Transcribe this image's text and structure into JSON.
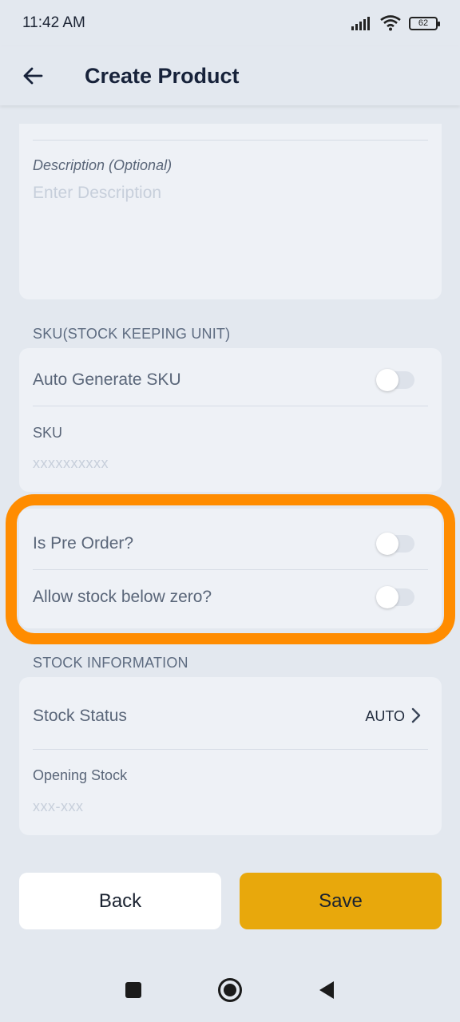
{
  "status_bar": {
    "time": "11:42 AM",
    "battery": "62"
  },
  "app_bar": {
    "title": "Create Product"
  },
  "description": {
    "label": "Description (Optional)",
    "placeholder": "Enter Description"
  },
  "sku_section": {
    "heading": "SKU(STOCK KEEPING UNIT)",
    "auto_generate_label": "Auto Generate SKU",
    "auto_generate_on": false,
    "sku_label": "SKU",
    "sku_placeholder": "xxxxxxxxxx"
  },
  "order_options": {
    "pre_order_label": "Is Pre Order?",
    "pre_order_on": false,
    "below_zero_label": "Allow stock below zero?",
    "below_zero_on": false
  },
  "stock_section": {
    "heading": "STOCK INFORMATION",
    "status_label": "Stock Status",
    "status_value": "AUTO",
    "opening_label": "Opening Stock",
    "opening_placeholder": "xxx-xxx"
  },
  "buttons": {
    "back": "Back",
    "save": "Save"
  },
  "colors": {
    "accent": "#E8A80C",
    "highlight": "#FF8C00",
    "background": "#E3E8EF"
  }
}
